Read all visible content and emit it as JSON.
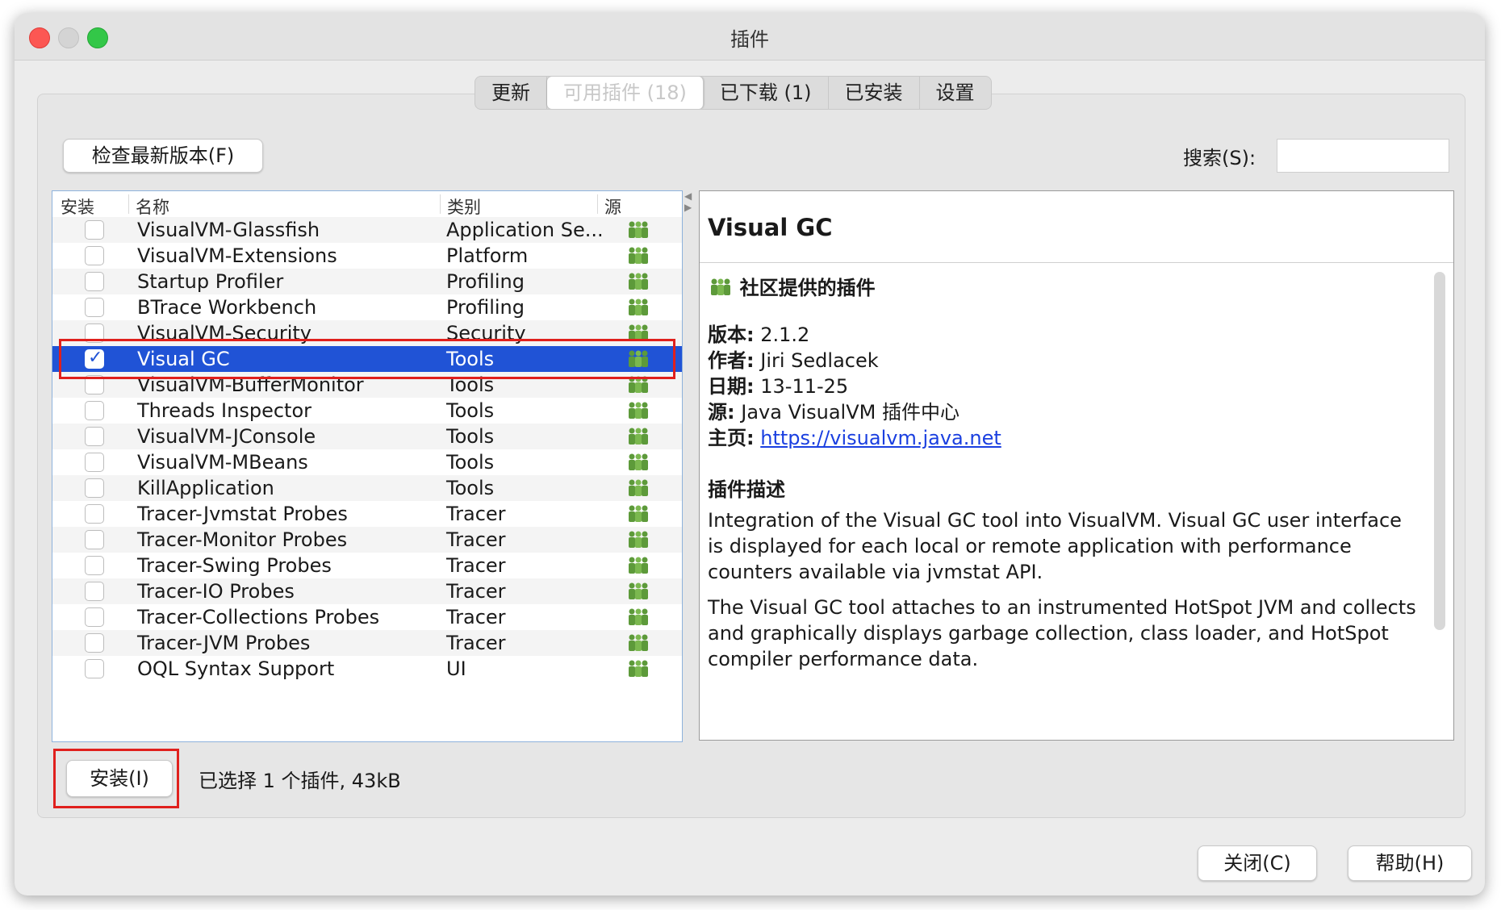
{
  "window": {
    "title": "插件"
  },
  "tabs": [
    {
      "label": "更新"
    },
    {
      "label": "可用插件 (18)",
      "active": true
    },
    {
      "label": "已下载 (1)"
    },
    {
      "label": "已安装"
    },
    {
      "label": "设置"
    }
  ],
  "toolbar": {
    "check_label": "检查最新版本(F)",
    "search_label": "搜索(S):",
    "search_value": ""
  },
  "table": {
    "columns": [
      "安装",
      "名称",
      "类别",
      "源"
    ],
    "rows": [
      {
        "name": "VisualVM-Glassfish",
        "category": "Application Se...",
        "checked": false
      },
      {
        "name": "VisualVM-Extensions",
        "category": "Platform",
        "checked": false
      },
      {
        "name": "Startup Profiler",
        "category": "Profiling",
        "checked": false
      },
      {
        "name": "BTrace Workbench",
        "category": "Profiling",
        "checked": false
      },
      {
        "name": "VisualVM-Security",
        "category": "Security",
        "checked": false
      },
      {
        "name": "Visual GC",
        "category": "Tools",
        "checked": true,
        "selected": true
      },
      {
        "name": "VisualVM-BufferMonitor",
        "category": "Tools",
        "checked": false
      },
      {
        "name": "Threads Inspector",
        "category": "Tools",
        "checked": false
      },
      {
        "name": "VisualVM-JConsole",
        "category": "Tools",
        "checked": false
      },
      {
        "name": "VisualVM-MBeans",
        "category": "Tools",
        "checked": false
      },
      {
        "name": "KillApplication",
        "category": "Tools",
        "checked": false
      },
      {
        "name": "Tracer-Jvmstat Probes",
        "category": "Tracer",
        "checked": false
      },
      {
        "name": "Tracer-Monitor Probes",
        "category": "Tracer",
        "checked": false
      },
      {
        "name": "Tracer-Swing Probes",
        "category": "Tracer",
        "checked": false
      },
      {
        "name": "Tracer-IO Probes",
        "category": "Tracer",
        "checked": false
      },
      {
        "name": "Tracer-Collections Probes",
        "category": "Tracer",
        "checked": false
      },
      {
        "name": "Tracer-JVM Probes",
        "category": "Tracer",
        "checked": false
      },
      {
        "name": "OQL Syntax Support",
        "category": "UI",
        "checked": false
      }
    ],
    "source_icon": "community-people-icon"
  },
  "details": {
    "title": "Visual GC",
    "provider": "社区提供的插件",
    "version_label": "版本:",
    "version": "2.1.2",
    "author_label": "作者:",
    "author": "Jiri Sedlacek",
    "date_label": "日期:",
    "date": "13-11-25",
    "source_label": "源:",
    "source": "Java VisualVM 插件中心",
    "homepage_label": "主页:",
    "homepage": "https://visualvm.java.net",
    "desc_heading": "插件描述",
    "desc_p1": "Integration of the Visual GC tool into VisualVM. Visual GC user interface is displayed for each local or remote application with performance counters available via jvmstat API.",
    "desc_p2": "The Visual GC tool attaches to an instrumented HotSpot JVM and collects and graphically displays garbage collection, class loader, and HotSpot compiler performance data."
  },
  "footer": {
    "install_label": "安装(I)",
    "status": "已选择 1 个插件, 43kB",
    "close_label": "关闭(C)",
    "help_label": "帮助(H)"
  },
  "colors": {
    "selection": "#2053d6",
    "highlight_box": "#e0201d",
    "link": "#1a3fe0"
  }
}
